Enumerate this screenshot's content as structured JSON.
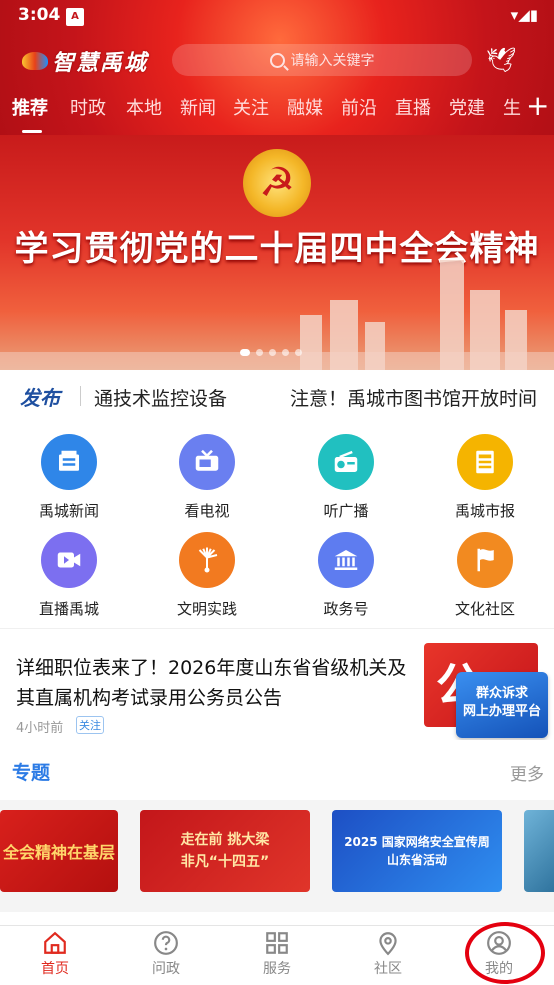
{
  "status_bar": {
    "time": "3:04",
    "notif_glyph": "A",
    "icons": "▾◢▮"
  },
  "header": {
    "app_name": "智慧禹城",
    "search_placeholder": "请输入关键字"
  },
  "tabs": [
    "推荐",
    "时政",
    "本地",
    "新闻",
    "关注",
    "融媒",
    "前沿",
    "直播",
    "党建",
    "生"
  ],
  "tab_add": "+",
  "banner": {
    "title": "学习贯彻党的二十届四中全会精神",
    "emblem_glyph": "☭",
    "slides": 5,
    "active_slide": 0
  },
  "ticker": {
    "badge": "发布",
    "items": [
      "通技术监控设备",
      "注意！禹城市图书馆开放时间"
    ]
  },
  "grid": [
    {
      "label": "禹城新闻",
      "icon": "news-icon",
      "color": "#2f86e8"
    },
    {
      "label": "看电视",
      "icon": "tv-icon",
      "color": "#6a7ff0"
    },
    {
      "label": "听广播",
      "icon": "radio-icon",
      "color": "#21c0c0"
    },
    {
      "label": "禹城市报",
      "icon": "newspaper-icon",
      "color": "#f5b400"
    },
    {
      "label": "直播禹城",
      "icon": "video-icon",
      "color": "#7c6ff0"
    },
    {
      "label": "文明实践",
      "icon": "hand-icon",
      "color": "#f27a20"
    },
    {
      "label": "政务号",
      "icon": "government-icon",
      "color": "#5e7cf0"
    },
    {
      "label": "文化社区",
      "icon": "flag-icon",
      "color": "#f28a20"
    }
  ],
  "news": {
    "title": "详细职位表来了！2026年度山东省省级机关及其直属机构考试录用公务员公告",
    "time": "4小时前",
    "follow": "关注",
    "thumb_text": "公"
  },
  "float_badge": {
    "line1": "群众诉求",
    "line2": "网上办理平台"
  },
  "topics": {
    "title": "专题",
    "more": "更多",
    "cards": [
      {
        "text": "全会精神在基层"
      },
      {
        "text": "走在前 挑大梁\n非凡“十四五”"
      },
      {
        "text": "2025 国家网络安全宣传周\n山东省活动"
      },
      {
        "text": ""
      }
    ]
  },
  "bottom_nav": [
    {
      "label": "首页",
      "icon": "home-icon",
      "active": true
    },
    {
      "label": "问政",
      "icon": "question-icon",
      "active": false
    },
    {
      "label": "服务",
      "icon": "grid-icon",
      "active": false
    },
    {
      "label": "社区",
      "icon": "location-icon",
      "active": false
    },
    {
      "label": "我的",
      "icon": "user-icon",
      "active": false
    }
  ],
  "colors": {
    "brand_red": "#e02a1f",
    "topic_blue": "#2c7be5",
    "highlight": "#e4000f"
  }
}
